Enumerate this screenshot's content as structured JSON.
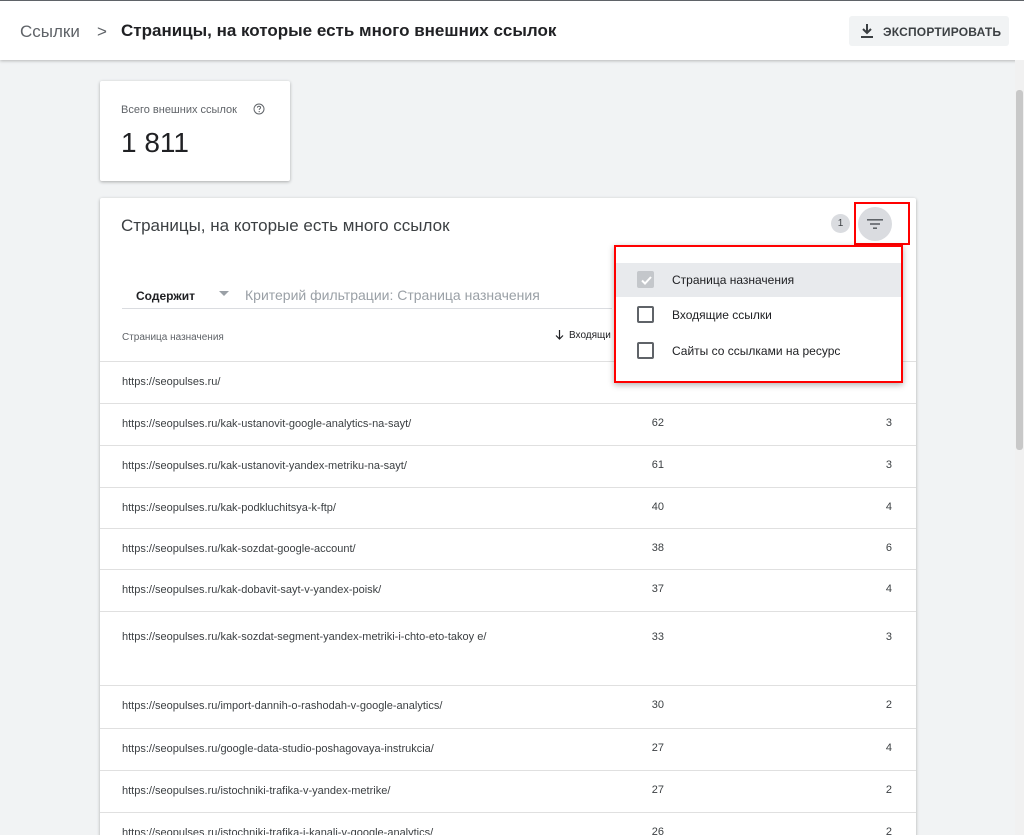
{
  "header": {
    "breadcrumb_root": "Ссылки",
    "breadcrumb_sep": ">",
    "title": "Страницы, на которые есть много внешних ссылок",
    "export_label": "ЭКСПОРТИРОВАТЬ"
  },
  "summary": {
    "label": "Всего внешних ссылок",
    "value": "1 811"
  },
  "table": {
    "title": "Страницы, на которые есть много ссылок",
    "filter_count": "1",
    "filter_operator": "Содержит",
    "filter_placeholder": "Критерий фильтрации: Страница назначения",
    "col_page": "Страница назначения",
    "col_incoming": "Входящи",
    "rows": [
      {
        "url": "https://seopulses.ru/",
        "incoming": "",
        "sites": ""
      },
      {
        "url": "https://seopulses.ru/kak-ustanovit-google-analytics-na-sayt/",
        "incoming": "62",
        "sites": "3"
      },
      {
        "url": "https://seopulses.ru/kak-ustanovit-yandex-metriku-na-sayt/",
        "incoming": "61",
        "sites": "3"
      },
      {
        "url": "https://seopulses.ru/kak-podkluchitsya-k-ftp/",
        "incoming": "40",
        "sites": "4"
      },
      {
        "url": "https://seopulses.ru/kak-sozdat-google-account/",
        "incoming": "38",
        "sites": "6"
      },
      {
        "url": "https://seopulses.ru/kak-dobavit-sayt-v-yandex-poisk/",
        "incoming": "37",
        "sites": "4"
      },
      {
        "url": "https://seopulses.ru/kak-sozdat-segment-yandex-metriki-i-chto-eto-takoy e/",
        "incoming": "33",
        "sites": "3"
      },
      {
        "url": "https://seopulses.ru/import-dannih-o-rashodah-v-google-analytics/",
        "incoming": "30",
        "sites": "2"
      },
      {
        "url": "https://seopulses.ru/google-data-studio-poshagovaya-instrukcia/",
        "incoming": "27",
        "sites": "4"
      },
      {
        "url": "https://seopulses.ru/istochniki-trafika-v-yandex-metrike/",
        "incoming": "27",
        "sites": "2"
      },
      {
        "url": "https://seopulses.ru/istochniki-trafika-i-kanali-v-google-analytics/",
        "incoming": "26",
        "sites": "2"
      }
    ]
  },
  "filter_menu": {
    "items": [
      {
        "label": "Страница назначения",
        "checked": true
      },
      {
        "label": "Входящие ссылки",
        "checked": false
      },
      {
        "label": "Сайты со ссылками на ресурс",
        "checked": false
      }
    ]
  },
  "colors": {
    "highlight": "#ff0000",
    "background": "#f1f3f4"
  }
}
